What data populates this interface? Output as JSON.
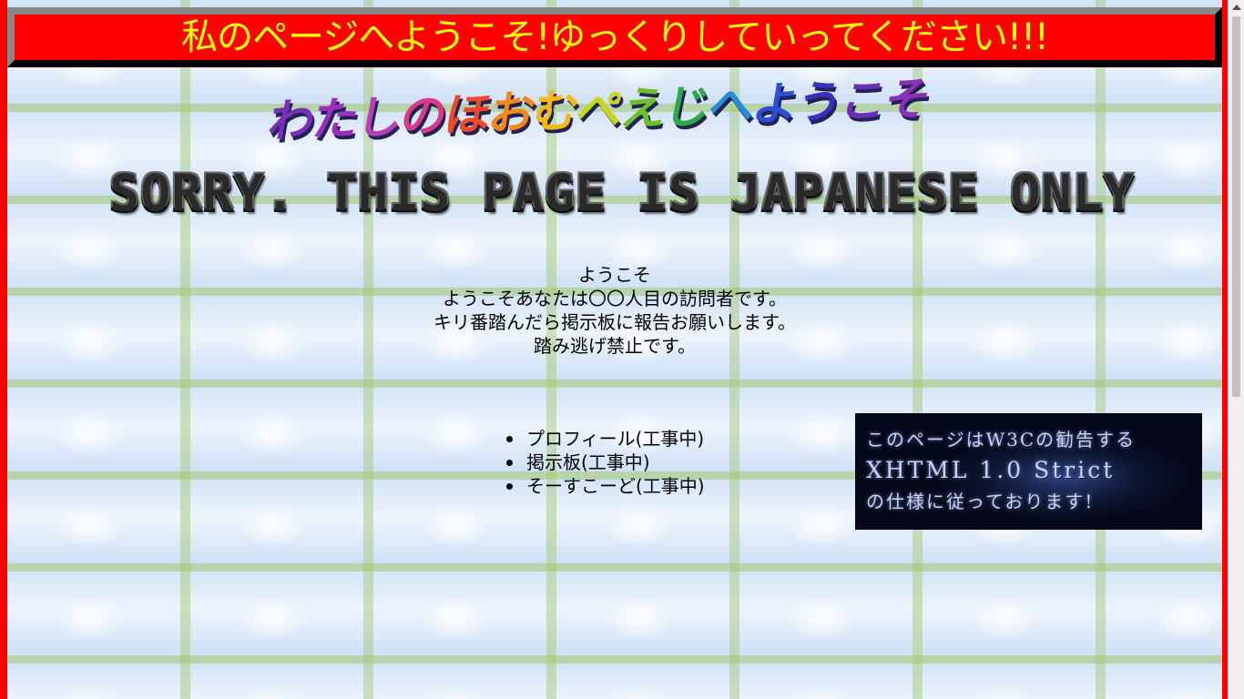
{
  "header": {
    "title": "私のページへようこそ!ゆっくりしていってください!!!",
    "background_color": "#ff0000",
    "text_color": "#ffff00"
  },
  "logo": {
    "text": "わたしのほおむぺえじへようこそ",
    "letter_colors": [
      "#7a2fb8",
      "#9a2fc0",
      "#b63fb5",
      "#d83a8a",
      "#ee4a2a",
      "#f2871c",
      "#f4b81b",
      "#c7d61d",
      "#6fbf2a",
      "#2fa84a",
      "#2a8ad6",
      "#2a4ed6",
      "#3a2fc0",
      "#6a2fb8",
      "#8a2fb8"
    ]
  },
  "banner": {
    "text": "SORRY. THIS PAGE IS JAPANESE ONLY"
  },
  "welcome": {
    "lines": [
      "ようこそ",
      "ようこそあなたは〇〇人目の訪問者です。",
      "キリ番踏んだら掲示板に報告お願いします。",
      "踏み逃げ禁止です。"
    ]
  },
  "menu": {
    "items": [
      {
        "label": "プロフィール(工事中)"
      },
      {
        "label": "掲示板(工事中)"
      },
      {
        "label": "そーすこーど(工事中)"
      }
    ]
  },
  "w3c_badge": {
    "line1": "このページはW3Cの勧告する",
    "line2": "XHTML 1.0 Strict",
    "line3": "の仕様に従っております!"
  }
}
